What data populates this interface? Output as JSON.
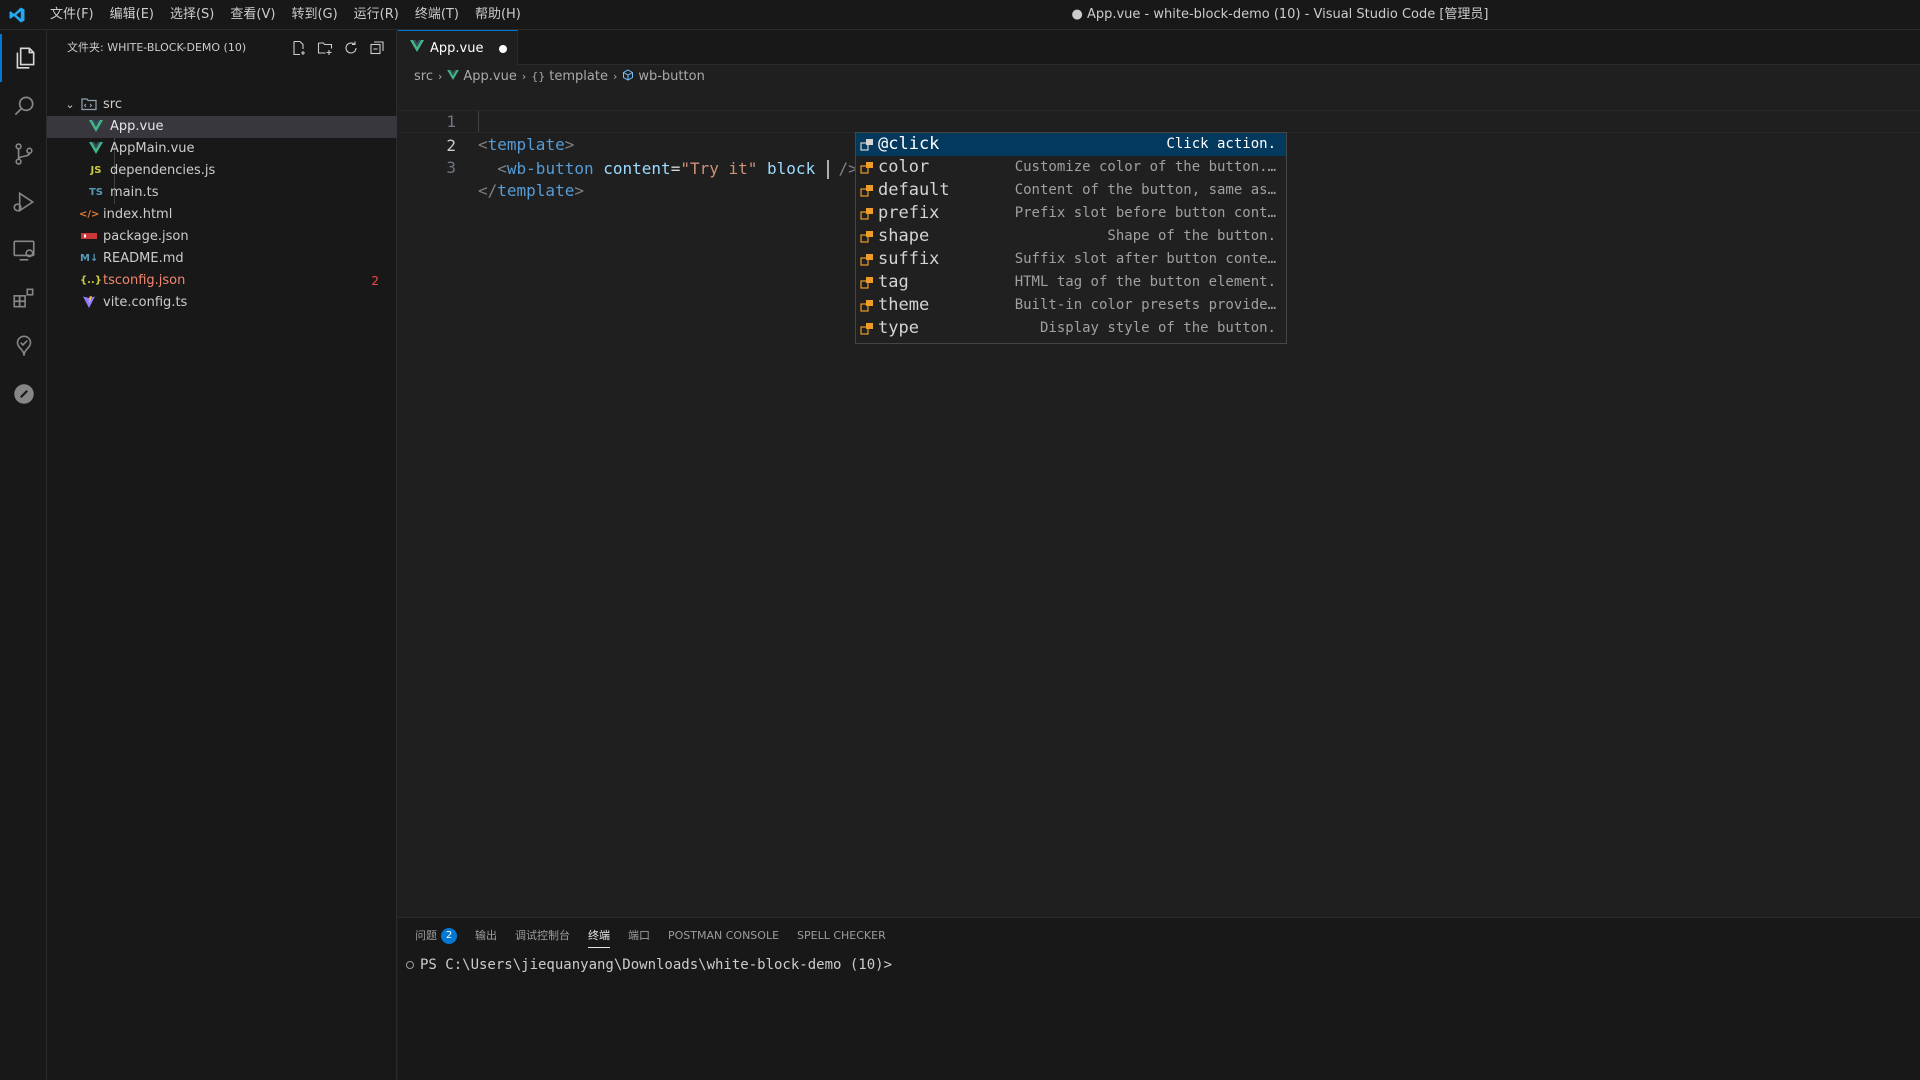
{
  "titlebar": {
    "menu": [
      "文件(F)",
      "编辑(E)",
      "选择(S)",
      "查看(V)",
      "转到(G)",
      "运行(R)",
      "终端(T)",
      "帮助(H)"
    ],
    "window_title": "● App.vue - white-block-demo (10) - Visual Studio Code [管理员]"
  },
  "sidebar": {
    "title": "文件夹: WHITE-BLOCK-DEMO (10)",
    "tree": [
      {
        "name": "src",
        "type": "folder",
        "icon": "folder-src-icon",
        "badge": ""
      },
      {
        "name": "App.vue",
        "type": "vue",
        "icon": "vue-icon",
        "badge": ""
      },
      {
        "name": "AppMain.vue",
        "type": "vue",
        "icon": "vue-icon",
        "badge": ""
      },
      {
        "name": "dependencies.js",
        "type": "js",
        "icon": "js-icon",
        "badge": ""
      },
      {
        "name": "main.ts",
        "type": "ts",
        "icon": "ts-icon",
        "badge": ""
      },
      {
        "name": "index.html",
        "type": "html",
        "icon": "html-icon",
        "badge": ""
      },
      {
        "name": "package.json",
        "type": "npm",
        "icon": "npm-icon",
        "badge": ""
      },
      {
        "name": "README.md",
        "type": "md",
        "icon": "markdown-icon",
        "badge": ""
      },
      {
        "name": "tsconfig.json",
        "type": "json",
        "icon": "json-icon",
        "badge": "2"
      },
      {
        "name": "vite.config.ts",
        "type": "vite",
        "icon": "vite-icon",
        "badge": ""
      }
    ]
  },
  "tab": {
    "name": "App.vue"
  },
  "breadcrumb": {
    "src": "src",
    "file": "App.vue",
    "template": "template",
    "element": "wb-button"
  },
  "editor": {
    "line_numbers": [
      "1",
      "2",
      "3"
    ],
    "line1": {
      "open": "<",
      "tag": "template",
      "close": ">"
    },
    "line2": {
      "indent": "  ",
      "open": "<",
      "tag": "wb-button",
      "attr1": "content",
      "eq": "=",
      "str": "\"Try it\"",
      "attr2": "block",
      "selfclose": "/>"
    },
    "line3": {
      "open": "</",
      "tag": "template",
      "close": ">"
    }
  },
  "suggest": [
    {
      "label": "@click",
      "desc": "Click action."
    },
    {
      "label": "color",
      "desc": "Customize color of the button.…"
    },
    {
      "label": "default",
      "desc": "Content of the button, same as…"
    },
    {
      "label": "prefix",
      "desc": "Prefix slot before button cont…"
    },
    {
      "label": "shape",
      "desc": "Shape of the button."
    },
    {
      "label": "suffix",
      "desc": "Suffix slot after button conte…"
    },
    {
      "label": "tag",
      "desc": "HTML tag of the button element."
    },
    {
      "label": "theme",
      "desc": "Built-in color presets provide…"
    },
    {
      "label": "type",
      "desc": "Display style of the button."
    }
  ],
  "panel": {
    "tabs": [
      "问题",
      "输出",
      "调试控制台",
      "终端",
      "端口",
      "POSTMAN CONSOLE",
      "SPELL CHECKER"
    ],
    "problems_count": "2",
    "terminal_line": "PS C:\\Users\\jiequanyang\\Downloads\\white-block-demo (10)>"
  },
  "colors": {
    "accent": "#0078d4",
    "vue": "#41b883",
    "error": "#f14c4c",
    "selection": "#04395e"
  }
}
